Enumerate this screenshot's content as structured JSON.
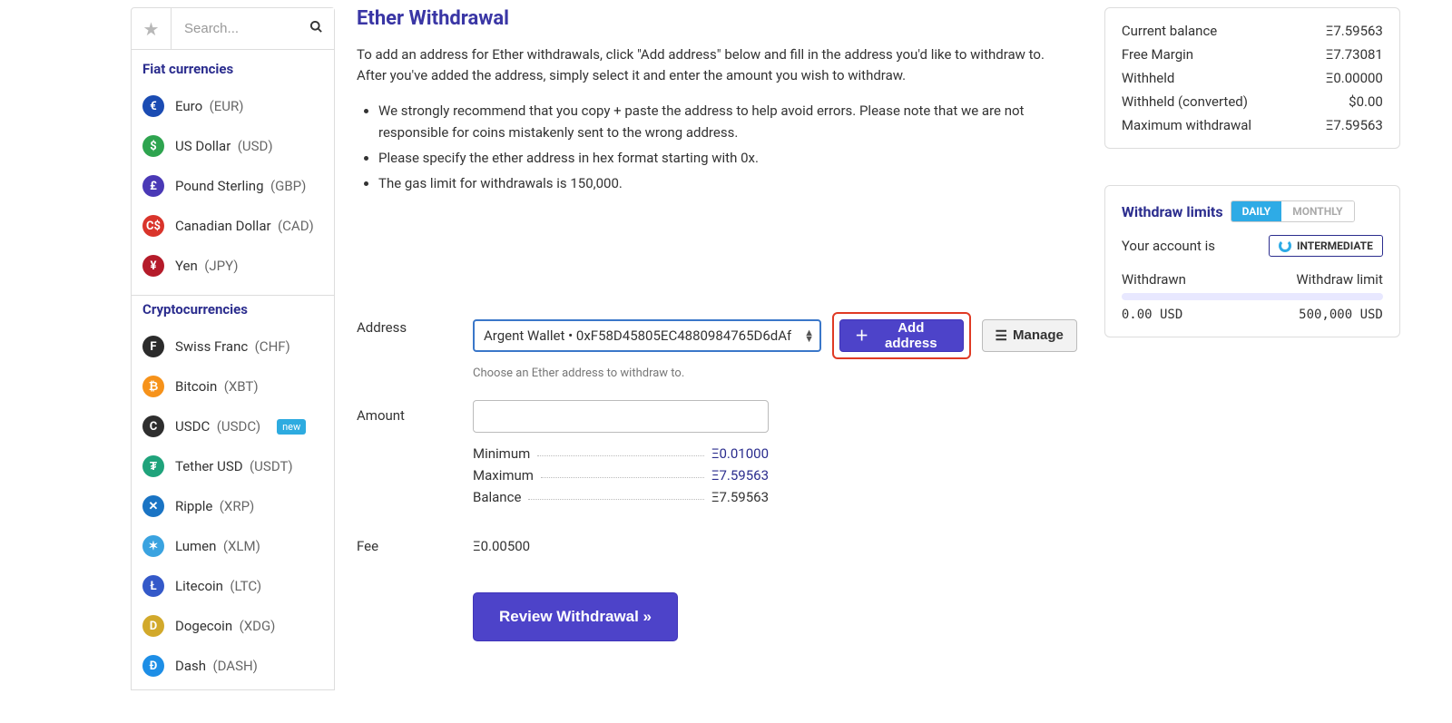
{
  "search": {
    "placeholder": "Search..."
  },
  "sidebar": {
    "fiat_title": "Fiat currencies",
    "crypto_title": "Cryptocurrencies",
    "fiat": [
      {
        "name": "Euro",
        "sym": "EUR",
        "bg": "#1b4cb3",
        "glyph": "€"
      },
      {
        "name": "US Dollar",
        "sym": "USD",
        "bg": "#2ea44f",
        "glyph": "$"
      },
      {
        "name": "Pound Sterling",
        "sym": "GBP",
        "bg": "#4a39b6",
        "glyph": "£"
      },
      {
        "name": "Canadian Dollar",
        "sym": "CAD",
        "bg": "#d9342b",
        "glyph": "C$"
      },
      {
        "name": "Yen",
        "sym": "JPY",
        "bg": "#b51b2a",
        "glyph": "¥"
      }
    ],
    "crypto": [
      {
        "name": "Swiss Franc",
        "sym": "CHF",
        "bg": "#2b2b2b",
        "glyph": "F"
      },
      {
        "name": "Bitcoin",
        "sym": "XBT",
        "bg": "#f6921a",
        "glyph": "₿"
      },
      {
        "name": "USDC",
        "sym": "USDC",
        "bg": "#2e2e2e",
        "glyph": "C",
        "new": "new"
      },
      {
        "name": "Tether USD",
        "sym": "USDT",
        "bg": "#1fa37b",
        "glyph": "₮"
      },
      {
        "name": "Ripple",
        "sym": "XRP",
        "bg": "#1a74c4",
        "glyph": "✕"
      },
      {
        "name": "Lumen",
        "sym": "XLM",
        "bg": "#3aa3e0",
        "glyph": "✶"
      },
      {
        "name": "Litecoin",
        "sym": "LTC",
        "bg": "#3459c9",
        "glyph": "Ł"
      },
      {
        "name": "Dogecoin",
        "sym": "XDG",
        "bg": "#d2a92b",
        "glyph": "D"
      },
      {
        "name": "Dash",
        "sym": "DASH",
        "bg": "#1d8ee6",
        "glyph": "Đ"
      }
    ]
  },
  "page": {
    "title": "Ether Withdrawal",
    "desc": "To add an address for Ether withdrawals, click \"Add address\" below and fill in the address you'd like to withdraw to. After you've added the address, simply select it and enter the amount you wish to withdraw.",
    "bullets": [
      "We strongly recommend that you copy + paste the address to help avoid errors. Please note that we are not responsible for coins mistakenly sent to the wrong address.",
      "Please specify the ether address in hex format starting with 0x.",
      "The gas limit for withdrawals is 150,000."
    ]
  },
  "form": {
    "address_label": "Address",
    "amount_label": "Amount",
    "fee_label": "Fee",
    "selected_address": "Argent Wallet • 0xF58D45805EC4880984765D6dAf",
    "hint": "Choose an Ether address to withdraw to.",
    "add_btn": "Add address",
    "manage_btn": "Manage",
    "min_label": "Minimum",
    "max_label": "Maximum",
    "bal_label": "Balance",
    "min": "Ξ0.01000",
    "max": "Ξ7.59563",
    "bal": "Ξ7.59563",
    "fee": "Ξ0.00500",
    "review": "Review Withdrawal »"
  },
  "balances": [
    {
      "label": "Current balance",
      "value": "Ξ7.59563"
    },
    {
      "label": "Free Margin",
      "value": "Ξ7.73081"
    },
    {
      "label": "Withheld",
      "value": "Ξ0.00000"
    },
    {
      "label": "Withheld (converted)",
      "value": "$0.00"
    },
    {
      "label": "Maximum withdrawal",
      "value": "Ξ7.59563"
    }
  ],
  "limits": {
    "title": "Withdraw limits",
    "tab_daily": "DAILY",
    "tab_monthly": "MONTHLY",
    "acct_text": "Your account is",
    "tier": "INTERMEDIATE",
    "withdrawn_label": "Withdrawn",
    "limit_label": "Withdraw limit",
    "withdrawn": "0.00 USD",
    "limit": "500,000 USD"
  }
}
